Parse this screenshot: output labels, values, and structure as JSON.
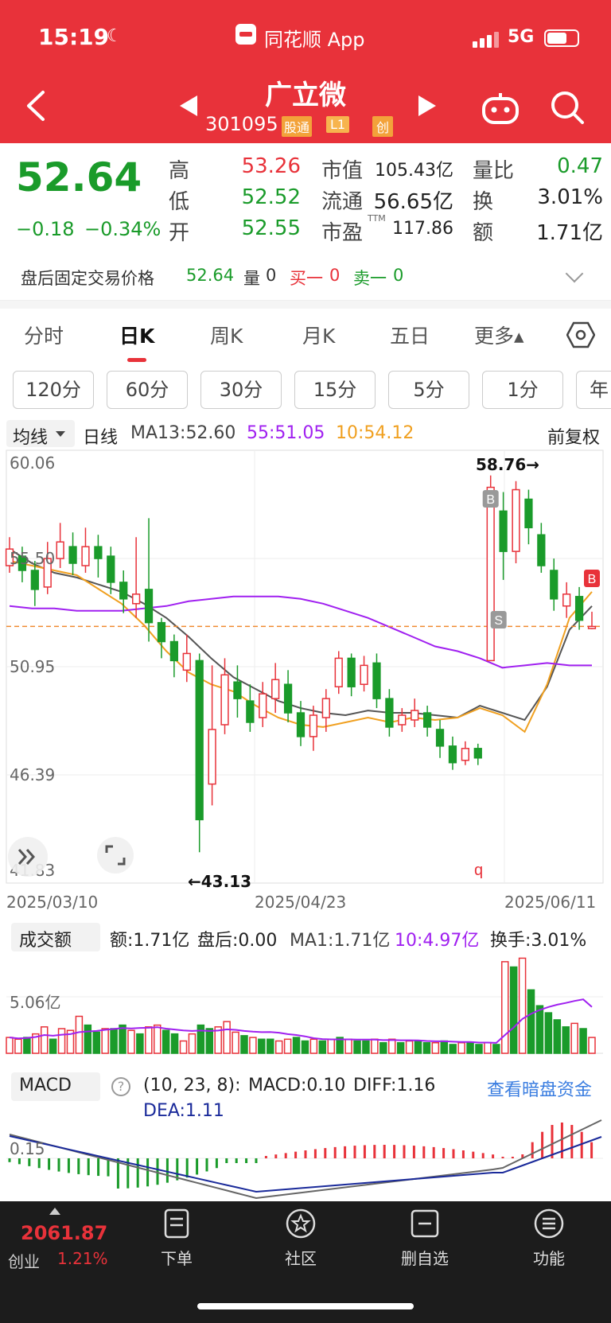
{
  "status": {
    "time": "15:19",
    "app": "同花顺 App",
    "network": "5G"
  },
  "header": {
    "title": "广立微",
    "code": "301095",
    "tag_hk": "股通",
    "tag_l1": "L1",
    "tag_cy": "创"
  },
  "quote": {
    "price": "52.64",
    "change": "−0.18",
    "change_pct": "−0.34%",
    "high_label": "高",
    "high": "53.26",
    "low_label": "低",
    "low": "52.52",
    "open_label": "开",
    "open": "52.55",
    "mktcap_label": "市值",
    "mktcap": "105.43亿",
    "float_label": "流通",
    "float": "56.65亿",
    "pe_label": "市盈",
    "pe_ttm": "TTM",
    "pe": "117.86",
    "vol_ratio_label": "量比",
    "vol_ratio": "0.47",
    "turnover_label": "换",
    "turnover": "3.01%",
    "amount_label": "额",
    "amount": "1.71亿"
  },
  "after_hours": {
    "label": "盘后固定交易价格",
    "price": "52.64",
    "vol_label": "量",
    "vol": "0",
    "buy_label": "买一",
    "buy": "0",
    "sell_label": "卖一",
    "sell": "0"
  },
  "tabs": [
    "分时",
    "日K",
    "周K",
    "月K",
    "五日",
    "更多▴"
  ],
  "active_tab": "日K",
  "intervals": [
    "120分",
    "60分",
    "30分",
    "15分",
    "5分",
    "1分",
    "年"
  ],
  "ma_bar": {
    "select": "均线",
    "period": "日线",
    "ma13": "MA13:52.60",
    "ma55": "55:51.05",
    "ma10": "10:54.12",
    "adjust": "前复权"
  },
  "colors": {
    "up": "#e8323a",
    "down": "#1a9b2a",
    "ma55": "#a020f0",
    "ma10": "#f0a020",
    "ma13": "#555555",
    "header": "#e8323a"
  },
  "chart_data": [
    {
      "type": "candlestick",
      "y_ticks": [
        "60.06",
        "55.50",
        "50.95",
        "46.39",
        "41.83"
      ],
      "ylim": [
        41.83,
        60.06
      ],
      "x_ticks": [
        "2025/03/10",
        "2025/04/23",
        "2025/06/11"
      ],
      "annotations": {
        "high": "58.76→",
        "low": "←43.13",
        "buy_marker": "B",
        "sell_marker": "S"
      },
      "series_ma": [
        {
          "name": "MA13",
          "values": [
            55.9,
            55.3,
            54.9,
            54.7,
            54.4,
            54.1,
            53.6,
            53.0,
            52.2,
            51.3,
            50.5,
            50.0,
            49.5,
            49.2,
            49.0,
            48.9,
            49.1,
            49.0,
            49.0,
            48.9,
            48.8,
            49.3,
            49.0,
            48.7,
            50.1,
            52.5,
            53.5
          ]
        },
        {
          "name": "10",
          "values": [
            55.4,
            55.2,
            55.0,
            54.8,
            54.2,
            53.6,
            52.7,
            51.6,
            50.7,
            50.2,
            49.9,
            49.3,
            48.8,
            48.5,
            48.4,
            48.6,
            48.8,
            48.6,
            48.8,
            48.7,
            48.8,
            49.2,
            48.9,
            48.2,
            50.2,
            53.0,
            54.1
          ]
        },
        {
          "name": "55",
          "values": [
            53.5,
            53.4,
            53.4,
            53.3,
            53.3,
            53.3,
            53.4,
            53.5,
            53.7,
            53.8,
            53.9,
            53.9,
            53.9,
            53.8,
            53.6,
            53.3,
            53.0,
            52.6,
            52.2,
            51.8,
            51.6,
            51.3,
            50.9,
            51.0,
            51.1,
            51.0,
            51.0
          ]
        }
      ],
      "candles": [
        [
          55.2,
          55.9,
          56.4,
          54.9
        ],
        [
          55.6,
          55.0,
          56.0,
          54.5
        ],
        [
          55.0,
          54.2,
          55.4,
          53.5
        ],
        [
          54.3,
          55.5,
          56.2,
          54.0
        ],
        [
          55.5,
          56.2,
          57.0,
          55.1
        ],
        [
          56.0,
          55.3,
          56.6,
          54.8
        ],
        [
          55.2,
          56.0,
          56.8,
          54.9
        ],
        [
          56.0,
          55.5,
          56.5,
          54.7
        ],
        [
          55.6,
          54.5,
          56.0,
          54.0
        ],
        [
          54.5,
          53.8,
          55.0,
          53.2
        ],
        [
          53.6,
          54.0,
          56.4,
          53.0
        ],
        [
          54.2,
          52.8,
          57.2,
          52.0
        ],
        [
          52.8,
          52.0,
          53.0,
          51.3
        ],
        [
          52.0,
          51.2,
          52.3,
          50.5
        ],
        [
          50.8,
          51.5,
          52.3,
          50.3
        ],
        [
          51.2,
          44.5,
          51.5,
          43.13
        ],
        [
          46.0,
          48.3,
          51.0,
          45.1
        ],
        [
          48.5,
          50.6,
          51.3,
          48.1
        ],
        [
          50.3,
          49.6,
          51.0,
          48.8
        ],
        [
          49.5,
          48.6,
          50.2,
          48.2
        ],
        [
          48.8,
          49.8,
          50.3,
          48.4
        ],
        [
          49.6,
          50.4,
          51.1,
          49.0
        ],
        [
          50.2,
          49.0,
          50.8,
          48.6
        ],
        [
          49.0,
          48.0,
          49.5,
          47.6
        ],
        [
          48.0,
          48.9,
          49.3,
          47.4
        ],
        [
          48.8,
          49.6,
          50.0,
          48.2
        ],
        [
          50.1,
          51.3,
          51.6,
          49.8
        ],
        [
          51.3,
          50.1,
          51.5,
          49.7
        ],
        [
          50.2,
          51.0,
          51.4,
          49.9
        ],
        [
          51.1,
          49.6,
          51.5,
          49.2
        ],
        [
          49.6,
          48.4,
          50.0,
          48.0
        ],
        [
          48.5,
          48.9,
          49.2,
          48.2
        ],
        [
          48.7,
          49.1,
          49.6,
          48.4
        ],
        [
          49.0,
          48.4,
          49.3,
          48.0
        ],
        [
          48.3,
          47.6,
          48.7,
          47.1
        ],
        [
          47.6,
          46.9,
          48.0,
          46.6
        ],
        [
          47.0,
          47.5,
          47.8,
          46.8
        ],
        [
          47.5,
          47.1,
          47.7,
          46.8
        ],
        [
          51.2,
          58.5,
          59.0,
          51.2
        ],
        [
          57.5,
          55.8,
          58.3,
          54.6
        ],
        [
          55.8,
          58.4,
          58.76,
          55.3
        ],
        [
          58.0,
          56.8,
          58.4,
          56.1
        ],
        [
          56.5,
          55.2,
          57.0,
          54.9
        ],
        [
          55.0,
          53.8,
          55.5,
          53.3
        ],
        [
          53.5,
          54.0,
          54.5,
          53.0
        ],
        [
          53.9,
          52.9,
          54.3,
          52.5
        ],
        [
          52.55,
          52.64,
          53.26,
          52.52
        ]
      ]
    },
    {
      "type": "bar",
      "name": "成交额",
      "y_ticks": [
        "5.06亿"
      ],
      "values": [
        0.9,
        0.8,
        0.9,
        1.1,
        1.5,
        0.8,
        1.4,
        1.3,
        2.1,
        1.6,
        1.2,
        1.4,
        1.4,
        1.6,
        1.3,
        1.1,
        1.5,
        1.6,
        1.3,
        1.1,
        0.7,
        1.1,
        1.6,
        1.4,
        1.5,
        1.8,
        1.2,
        1.0,
        0.9,
        0.8,
        0.8,
        0.7,
        0.8,
        0.9,
        0.7,
        0.8,
        0.7,
        0.8,
        0.9,
        0.8,
        0.7,
        0.7,
        0.8,
        0.6,
        0.8,
        0.6,
        0.7,
        0.7,
        0.6,
        0.6,
        0.7,
        0.5,
        0.6,
        0.6,
        0.5,
        0.6,
        0.5,
        5.2,
        4.9,
        5.4,
        3.6,
        2.7,
        2.3,
        1.9,
        1.5,
        1.7,
        1.4,
        0.9
      ],
      "up_flags": [
        1,
        1,
        0,
        1,
        1,
        0,
        1,
        1,
        1,
        0,
        0,
        1,
        0,
        0,
        1,
        0,
        1,
        1,
        0,
        0,
        1,
        1,
        0,
        0,
        1,
        1,
        1,
        0,
        1,
        0,
        0,
        1,
        1,
        0,
        0,
        1,
        0,
        1,
        0,
        1,
        0,
        0,
        1,
        0,
        1,
        0,
        1,
        0,
        0,
        1,
        0,
        0,
        1,
        0,
        0,
        1,
        0,
        1,
        0,
        1,
        0,
        0,
        0,
        0,
        0,
        1,
        0,
        1
      ],
      "info": {
        "select": "成交额",
        "amount": "额:1.71亿",
        "after": "盘后:0.00",
        "ma1": "MA1:1.71亿",
        "ma10": "10:4.97亿",
        "turnover": "换手:3.01%"
      }
    },
    {
      "type": "bar",
      "name": "MACD",
      "y_ticks": [
        "0.15"
      ],
      "info": {
        "select": "MACD",
        "params": "(10, 23, 8):",
        "macd": "MACD:0.10",
        "diff": "DIFF:1.16",
        "dea": "DEA:1.11",
        "link": "查看暗盘资金"
      }
    }
  ],
  "bottom": {
    "index_value": "2061.87",
    "index_name": "创业",
    "index_pct": "1.21%",
    "items": [
      "下单",
      "社区",
      "删自选",
      "功能"
    ]
  }
}
